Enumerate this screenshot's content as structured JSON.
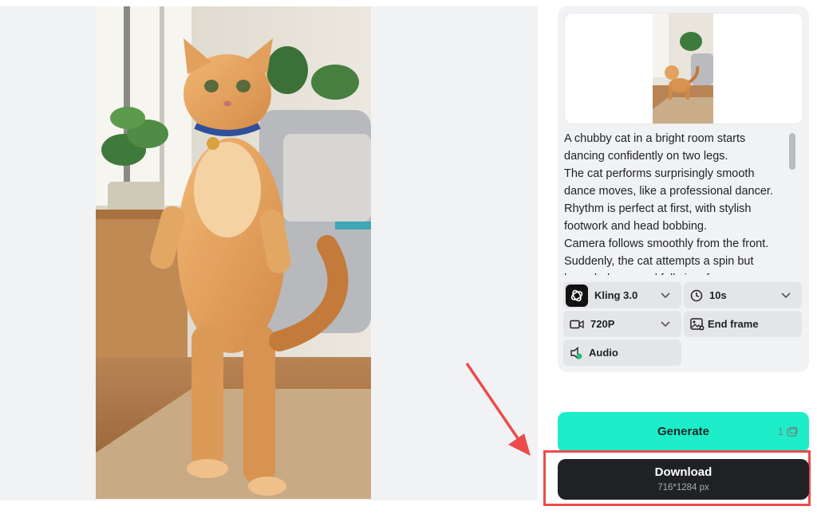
{
  "preview": {
    "aspect": "9:16"
  },
  "reference": {
    "description_hidden": true
  },
  "prompt": {
    "lines": [
      "A chubby cat in a bright room starts dancing confidently on two legs.",
      "The cat performs surprisingly smooth dance moves, like a professional dancer.",
      "Rhythm is perfect at first, with stylish footwork and head bobbing.",
      "Camera follows smoothly from the front.",
      "Suddenly, the cat attempts a spin but loses balance and falls in a funny way."
    ]
  },
  "options": {
    "model": "Kling 3.0",
    "duration": "10s",
    "resolution": "720P",
    "end_frame": "End frame",
    "audio": "Audio"
  },
  "actions": {
    "generate_label": "Generate",
    "generate_cost": "1",
    "download_label": "Download",
    "download_size": "716*1284 px"
  },
  "colors": {
    "generate_bg": "#1dedc8",
    "download_bg": "#1f2125",
    "highlight": "#ec4b4b"
  }
}
